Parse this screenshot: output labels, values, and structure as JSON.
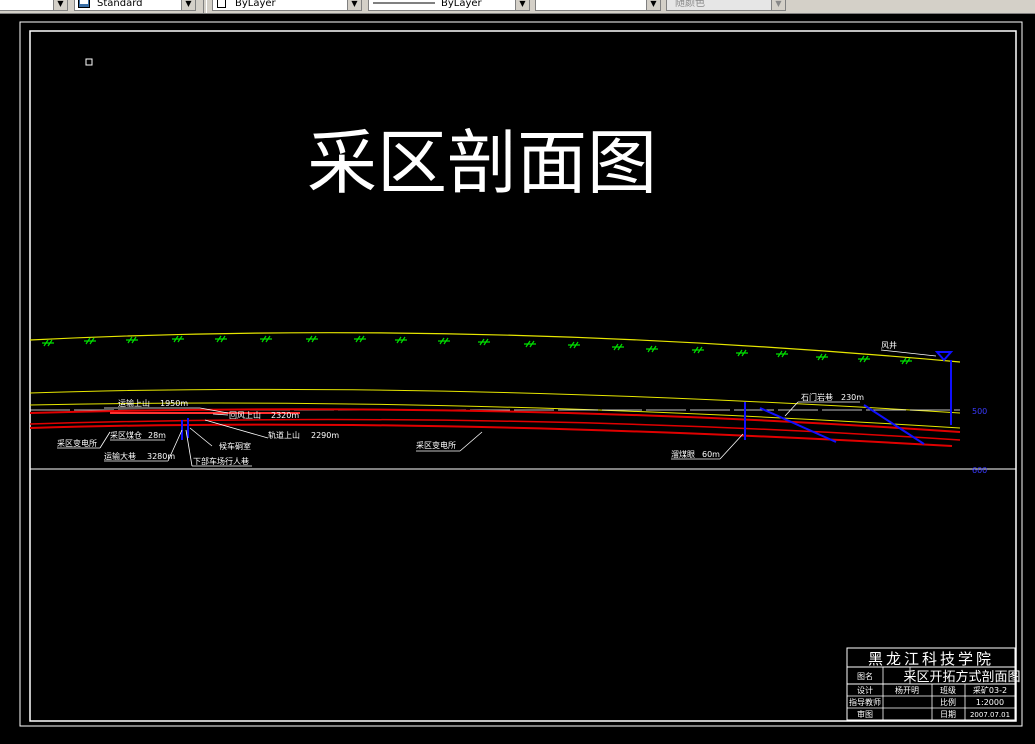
{
  "toolbar": {
    "style_combo": "Standard",
    "layer_combo": "ByLayer",
    "linetype_combo": "ByLayer",
    "lineweight_combo": "",
    "color_combo": "随颜色"
  },
  "drawing": {
    "title": "采区剖面图",
    "labels": {
      "ventilation_shaft": "风井",
      "level_top": "500",
      "level_bottom": "600",
      "transport_up": "运输上山",
      "transport_up_len": "1950m",
      "return_up": "回风上山",
      "return_up_len": "2320m",
      "track_up": "轨道上山",
      "track_up_len": "2290m",
      "coal_bin": "采区煤仓",
      "coal_bin_len": "28m",
      "section_station_left": "采区变电所",
      "transport_main": "运输大巷",
      "transport_main_len": "3280m",
      "lower_pedestrian": "下部车场行人巷",
      "waiting_room": "候车硐室",
      "section_station_mid": "采区变电所",
      "stone_gate": "石门岩巷",
      "stone_gate_len": "230m",
      "drain_hole": "溜煤眼",
      "drain_hole_len": "60m"
    }
  },
  "title_block": {
    "school": "黑龙江科技学院",
    "drawing_name_label": "图名",
    "drawing_name": "采区开拓方式剖面图",
    "design_label": "设计",
    "designer": "杨开明",
    "class_label": "班级",
    "class_value": "采矿03-2",
    "advisor_label": "指导教师",
    "advisor": "",
    "scale_label": "比例",
    "scale_value": "1:2000",
    "review_label": "审图",
    "reviewer": "",
    "date_label": "日期",
    "date_value": "2007.07.01"
  },
  "colors": {
    "background": "#000000",
    "frame": "#ffffff",
    "surface_line": "#e6e600",
    "grass": "#00e000",
    "roadway": "#e00000",
    "shaft": "#1010ff",
    "label": "#ffffff"
  }
}
